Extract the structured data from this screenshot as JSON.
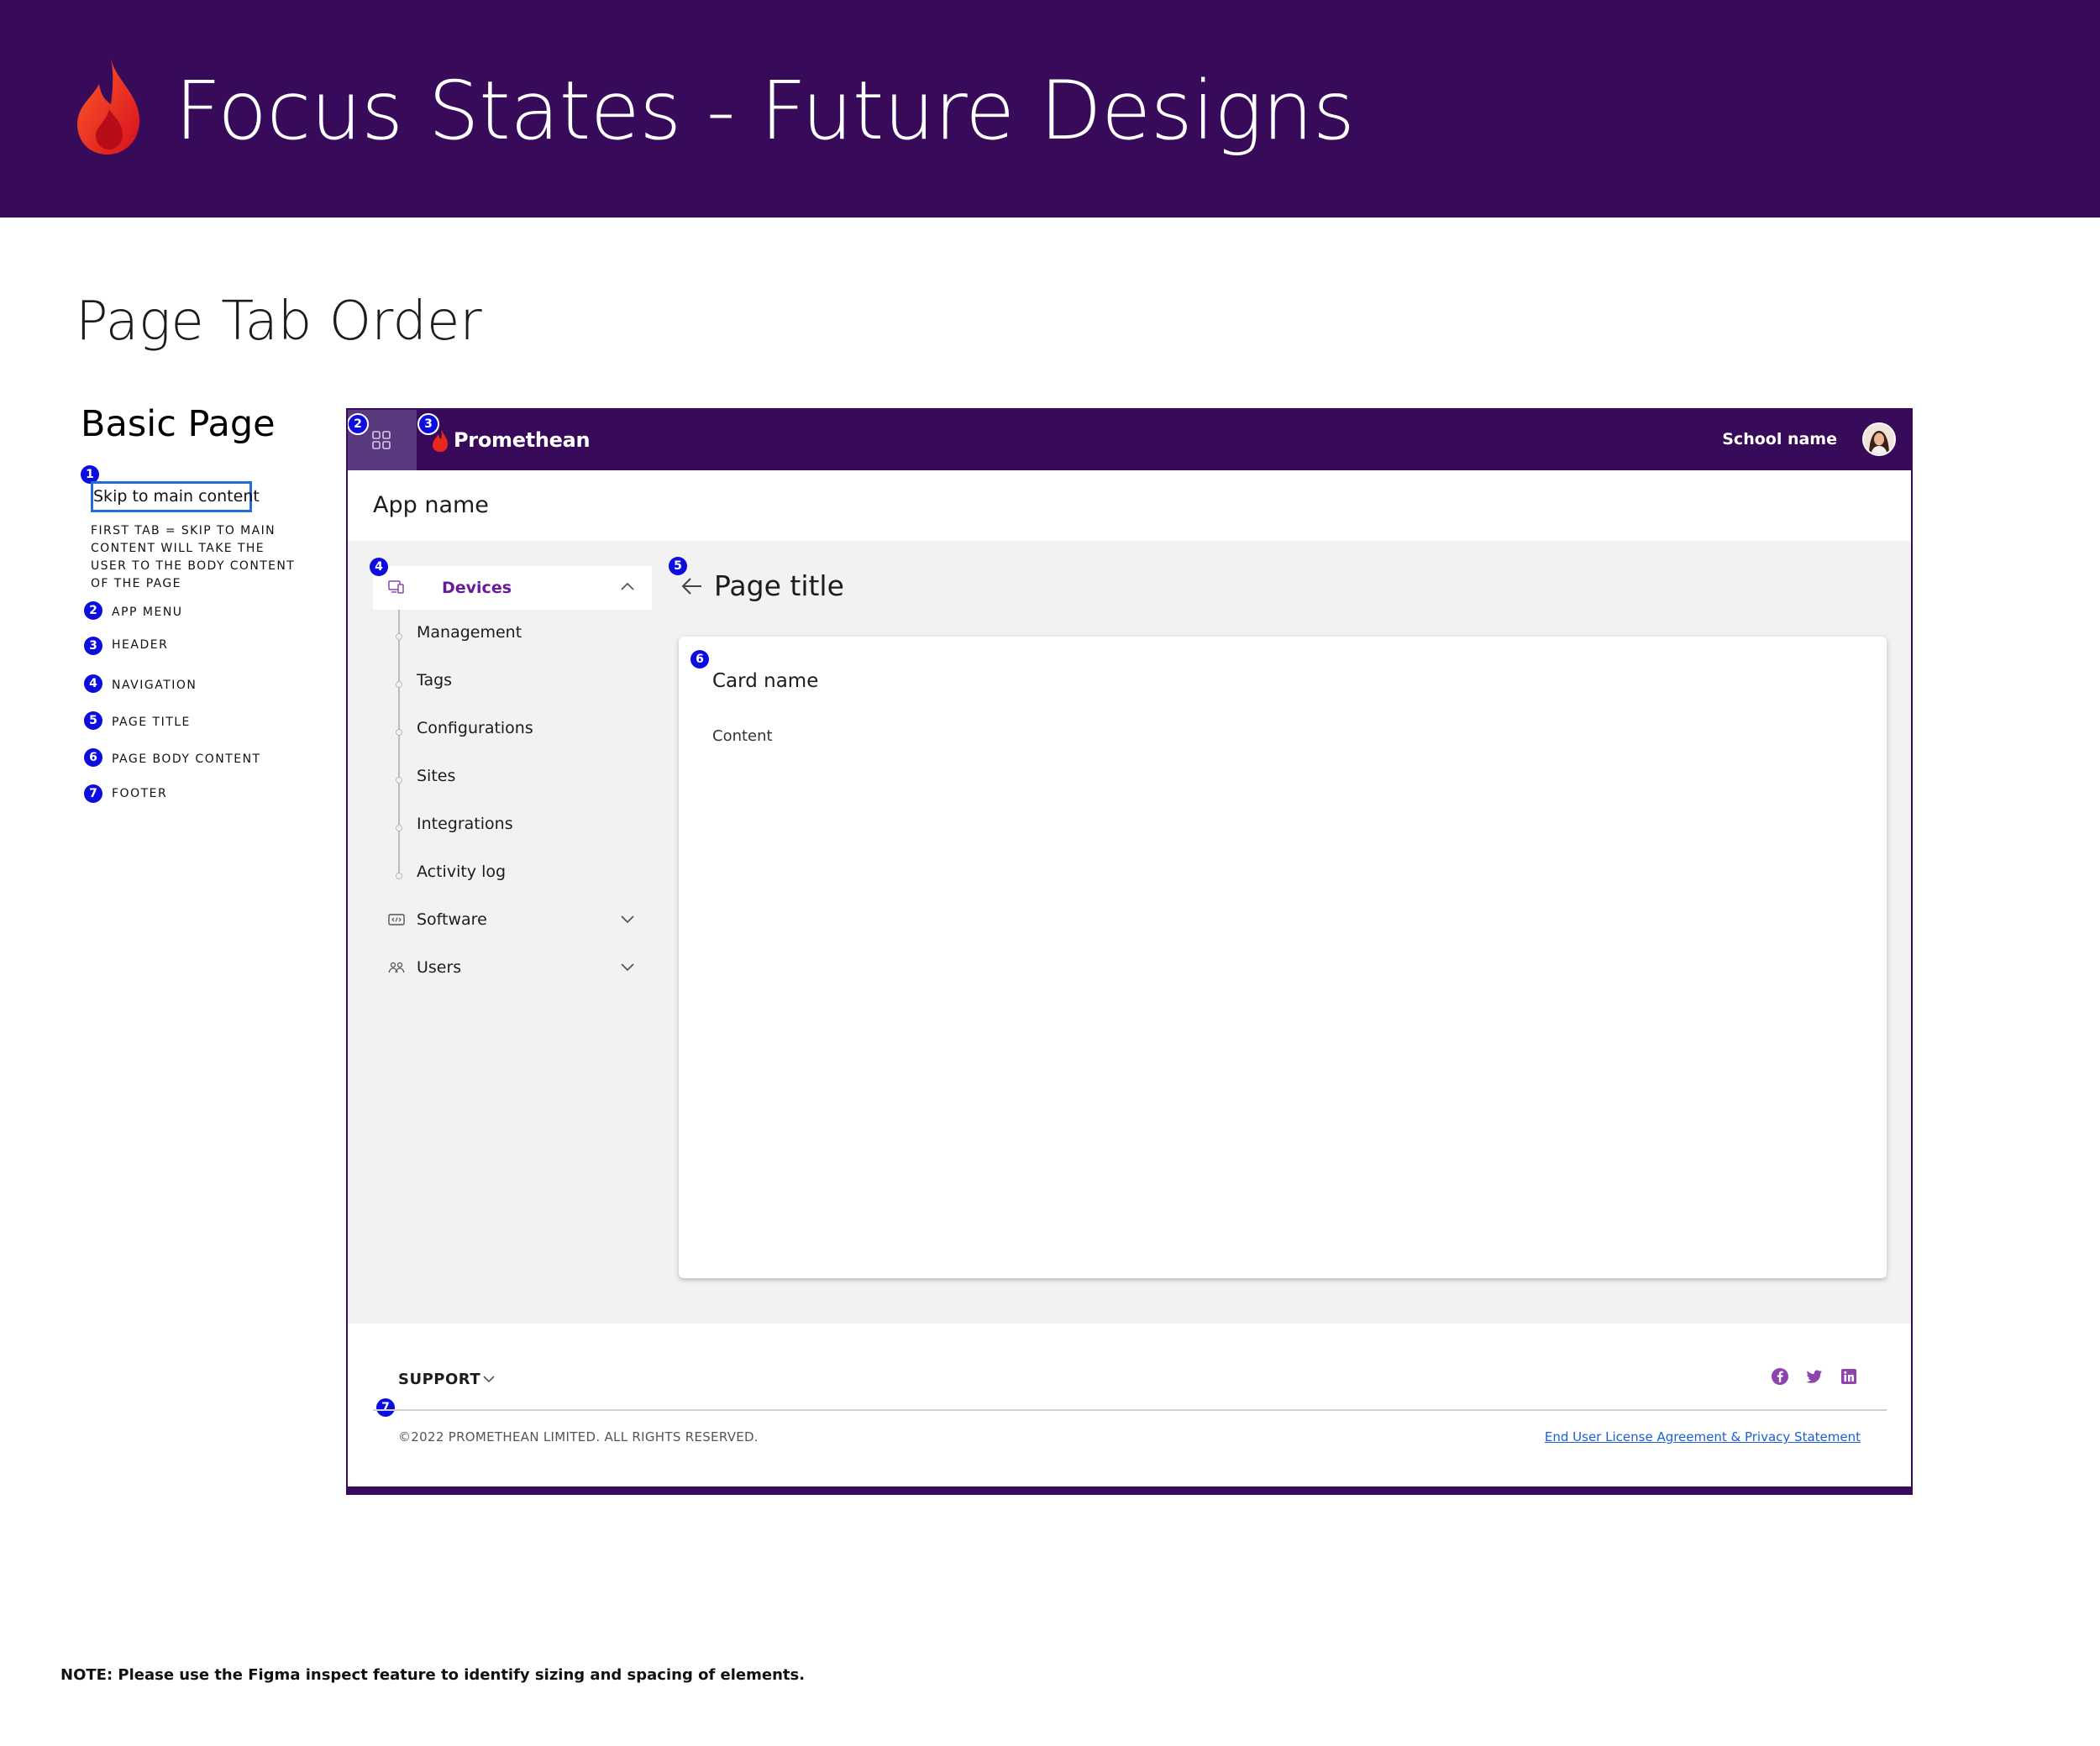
{
  "banner": {
    "title": "Focus States - Future Designs"
  },
  "section_title": "Page Tab Order",
  "legend": {
    "title": "Basic Page",
    "skip_button": "Skip to main content",
    "skip_description": "FIRST TAB = SKIP TO MAIN CONTENT WILL TAKE THE USER TO THE BODY CONTENT OF THE PAGE",
    "items": [
      {
        "num": "1"
      },
      {
        "num": "2",
        "label": "APP MENU"
      },
      {
        "num": "3",
        "label": "HEADER"
      },
      {
        "num": "4",
        "label": "NAVIGATION"
      },
      {
        "num": "5",
        "label": "PAGE TITLE"
      },
      {
        "num": "6",
        "label": "PAGE BODY CONTENT"
      },
      {
        "num": "7",
        "label": "FOOTER"
      }
    ]
  },
  "app": {
    "brand": "Promethean",
    "school_name": "School name",
    "app_name": "App name",
    "nav": {
      "devices": "Devices",
      "sub_items": [
        "Management",
        "Tags",
        "Configurations",
        "Sites",
        "Integrations",
        "Activity log"
      ],
      "software": "Software",
      "users": "Users"
    },
    "page_title": "Page title",
    "card": {
      "name": "Card name",
      "content": "Content"
    },
    "footer": {
      "support": "SUPPORT",
      "copyright": "©2022 PROMETHEAN LIMITED. ALL RIGHTS RESERVED.",
      "legal_link": "End User License Agreement & Privacy Statement"
    }
  },
  "note": "NOTE: Please use the Figma inspect feature to identify sizing and spacing of elements.",
  "colors": {
    "brand_purple": "#370b5a",
    "focus_badge": "#0d0ddd",
    "nav_active": "#6a1b9a",
    "link": "#1f5fd0",
    "flame_red": "#e8281e"
  }
}
